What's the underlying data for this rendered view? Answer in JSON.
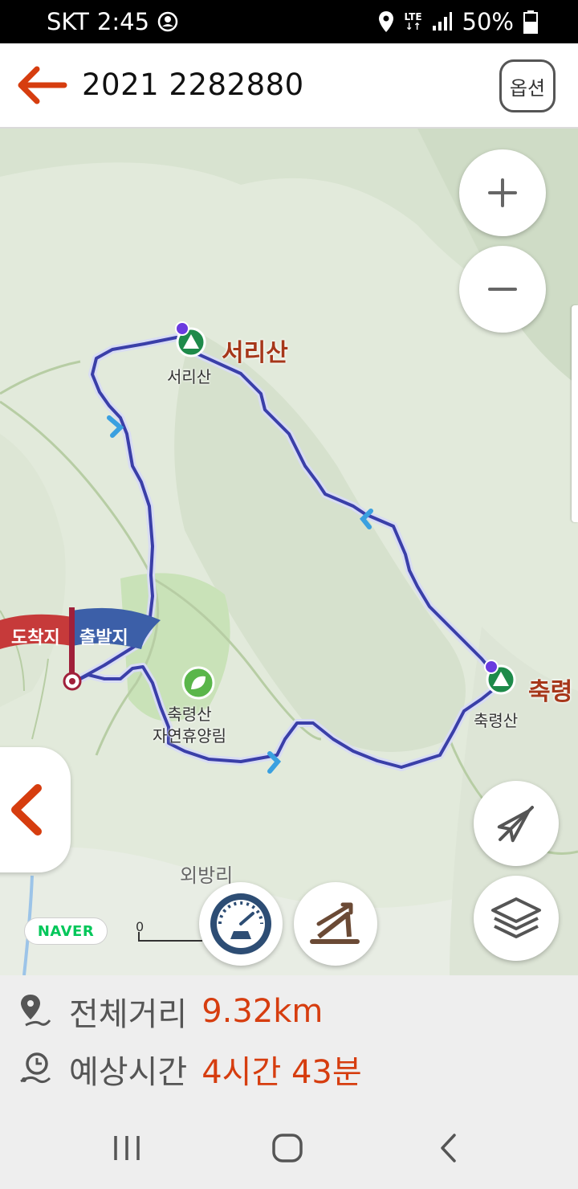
{
  "status_bar": {
    "carrier": "SKT",
    "time": "2:45",
    "network": "LTE",
    "battery": "50%"
  },
  "header": {
    "title": "2021 2282880",
    "back_icon": "arrow-left-icon",
    "options_label": "옵션"
  },
  "map": {
    "peaks": [
      {
        "name": "서리산",
        "label": "서리산"
      },
      {
        "name": "축령",
        "label": "축령산"
      }
    ],
    "forest_label": "축령산\n자연휴양림",
    "village_label": "외방리",
    "start_label": "출발지",
    "end_label": "도착지",
    "naver_logo": "NAVER",
    "scale_label": "0",
    "zoom_in_icon": "plus-icon",
    "zoom_out_icon": "minus-icon",
    "compass_icon": "compass-off-icon",
    "layers_icon": "layers-icon",
    "speed_icon": "speedometer-icon",
    "elevation_icon": "elevation-icon",
    "collapse_icon": "chevron-left-icon"
  },
  "info": {
    "distance_label": "전체거리",
    "distance_value": "9.32km",
    "time_label": "예상시간",
    "time_value": "4시간 43분"
  },
  "colors": {
    "accent": "#d63d0f",
    "route": "#3a3fa8",
    "map_bg": "#e3ebdc"
  }
}
